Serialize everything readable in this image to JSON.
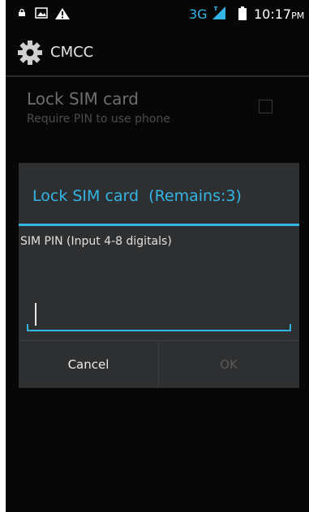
{
  "status_bar": {
    "network_type": "3G",
    "time": "10:17",
    "ampm": "PM",
    "icons": [
      "lock-icon",
      "image-icon",
      "warning-icon",
      "signal-icon",
      "battery-icon"
    ]
  },
  "action_bar": {
    "title": "CMCC",
    "icon": "gear-icon"
  },
  "preference": {
    "title": "Lock SIM card",
    "summary": "Require PIN to use phone",
    "checked": false
  },
  "dialog": {
    "title": "Lock SIM card  (Remains:3)",
    "message": "SIM PIN (Input 4-8 digitals)",
    "pin_value": "",
    "cancel_label": "Cancel",
    "ok_label": "OK",
    "ok_enabled": false
  },
  "colors": {
    "accent": "#33b5e5",
    "background": "#070707",
    "dialog": "#2d2f31"
  }
}
